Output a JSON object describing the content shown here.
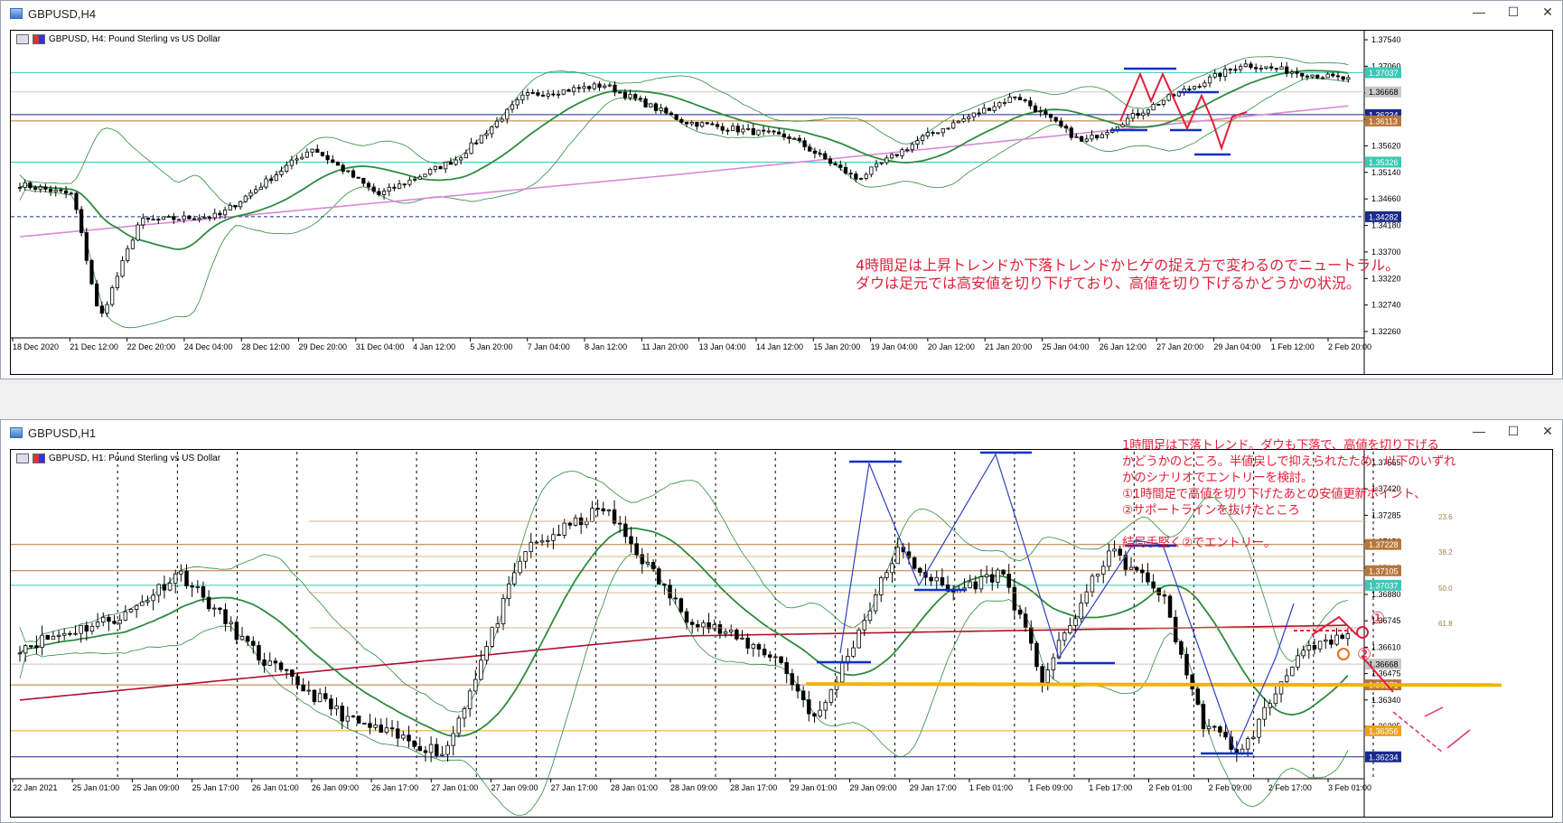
{
  "windows": [
    {
      "title": "GBPUSD,H4",
      "controls": [
        "—",
        "☐",
        "✕"
      ]
    },
    {
      "title": "GBPUSD,H1",
      "controls": [
        "—",
        "☐",
        "✕"
      ]
    }
  ],
  "chart_data": [
    {
      "type": "candlestick",
      "symbol_label": "GBPUSD, H4:  Pound Sterling vs US Dollar",
      "y_ticks": [
        "1.37540",
        "1.37060",
        "1.36580",
        "1.36080",
        "1.35620",
        "1.35140",
        "1.34660",
        "1.34180",
        "1.33700",
        "1.33220",
        "1.32740",
        "1.32260"
      ],
      "ylim": [
        1.32,
        1.377
      ],
      "x_ticks": [
        "18 Dec 2020",
        "21 Dec 12:00",
        "22 Dec 20:00",
        "24 Dec 04:00",
        "28 Dec 12:00",
        "29 Dec 20:00",
        "31 Dec 04:00",
        "4 Jan 12:00",
        "5 Jan 20:00",
        "7 Jan 04:00",
        "8 Jan 12:00",
        "11 Jan 20:00",
        "13 Jan 04:00",
        "14 Jan 12:00",
        "15 Jan 20:00",
        "19 Jan 04:00",
        "20 Jan 12:00",
        "21 Jan 20:00",
        "25 Jan 04:00",
        "26 Jan 12:00",
        "27 Jan 20:00",
        "29 Jan 04:00",
        "1 Feb 12:00",
        "2 Feb 20:00"
      ],
      "price_tags": [
        {
          "label": "1.37037",
          "value": 1.37037,
          "color": "#3cc8b4"
        },
        {
          "label": "1.36668",
          "value": 1.36668,
          "color": "#c8c8c8"
        },
        {
          "label": "1.36234",
          "value": 1.36234,
          "color": "#1a2a8a"
        },
        {
          "label": "1.36113",
          "value": 1.36113,
          "color": "#b8763a"
        },
        {
          "label": "1.35326",
          "value": 1.35326,
          "color": "#3cc8b4"
        },
        {
          "label": "1.34282",
          "value": 1.34282,
          "color": "#1a2a8a"
        }
      ],
      "annotation": "4時間足は上昇トレンドか下落トレンドかヒゲの捉え方で変わるのでニュートラル。\nダウは足元では高安値を切り下げており、高値を切り下げるかどうかの状況。",
      "colors": {
        "candle": "#000000",
        "ma": "#2e8b3e",
        "ma_long": "#d889d8",
        "bands": "#2e8b3e",
        "annotation": "#e0203a"
      }
    },
    {
      "type": "candlestick",
      "symbol_label": "GBPUSD, H1:  Pound Sterling vs US Dollar",
      "y_ticks": [
        "1.37555",
        "1.37420",
        "1.37285",
        "1.37150",
        "1.37015",
        "1.36880",
        "1.36745",
        "1.36610",
        "1.36475",
        "1.36340",
        "1.36205"
      ],
      "ylim": [
        1.3614,
        1.3762
      ],
      "x_ticks": [
        "22 Jan 2021",
        "25 Jan 01:00",
        "25 Jan 09:00",
        "25 Jan 17:00",
        "26 Jan 01:00",
        "26 Jan 09:00",
        "26 Jan 17:00",
        "27 Jan 01:00",
        "27 Jan 09:00",
        "27 Jan 17:00",
        "28 Jan 01:00",
        "28 Jan 09:00",
        "28 Jan 17:00",
        "29 Jan 01:00",
        "29 Jan 09:00",
        "29 Jan 17:00",
        "1 Feb 01:00",
        "1 Feb 09:00",
        "1 Feb 17:00",
        "2 Feb 01:00",
        "2 Feb 09:00",
        "2 Feb 17:00",
        "3 Feb 01:00"
      ],
      "price_tags": [
        {
          "label": "1.37228",
          "value": 1.37228,
          "color": "#b8763a"
        },
        {
          "label": "1.37105",
          "value": 1.37105,
          "color": "#b8763a"
        },
        {
          "label": "1.37037",
          "value": 1.37037,
          "color": "#3cc8b4"
        },
        {
          "label": "1.36668",
          "value": 1.36668,
          "color": "#c8c8c8"
        },
        {
          "label": "1.36571",
          "value": 1.36571,
          "color": "#b8763a"
        },
        {
          "label": "1.36356",
          "value": 1.36356,
          "color": "#f0a020"
        },
        {
          "label": "1.36234",
          "value": 1.36234,
          "color": "#1a2a8a"
        }
      ],
      "fib_levels": [
        "23.6",
        "38.2",
        "50.0",
        "61.8"
      ],
      "circled_markers": [
        "①",
        "②"
      ],
      "annotation": "1時間足は下落トレンド。ダウも下落で、高値を切り下げる\nかどうかのところ。半値戻しで抑えられたため、以下のいずれ\nかのシナリオでエントリーを検討。\n①1時間足で高値を切り下げたあとの安値更新ポイント、\n②サポートラインを抜けたところ\n\n結局手堅く②でエントリー。",
      "colors": {
        "candle": "#000000",
        "ma": "#2e8b3e",
        "ma_long": "#b01030",
        "bands": "#2e8b3e",
        "support": "#f0b400",
        "annotation": "#e0203a"
      }
    }
  ]
}
